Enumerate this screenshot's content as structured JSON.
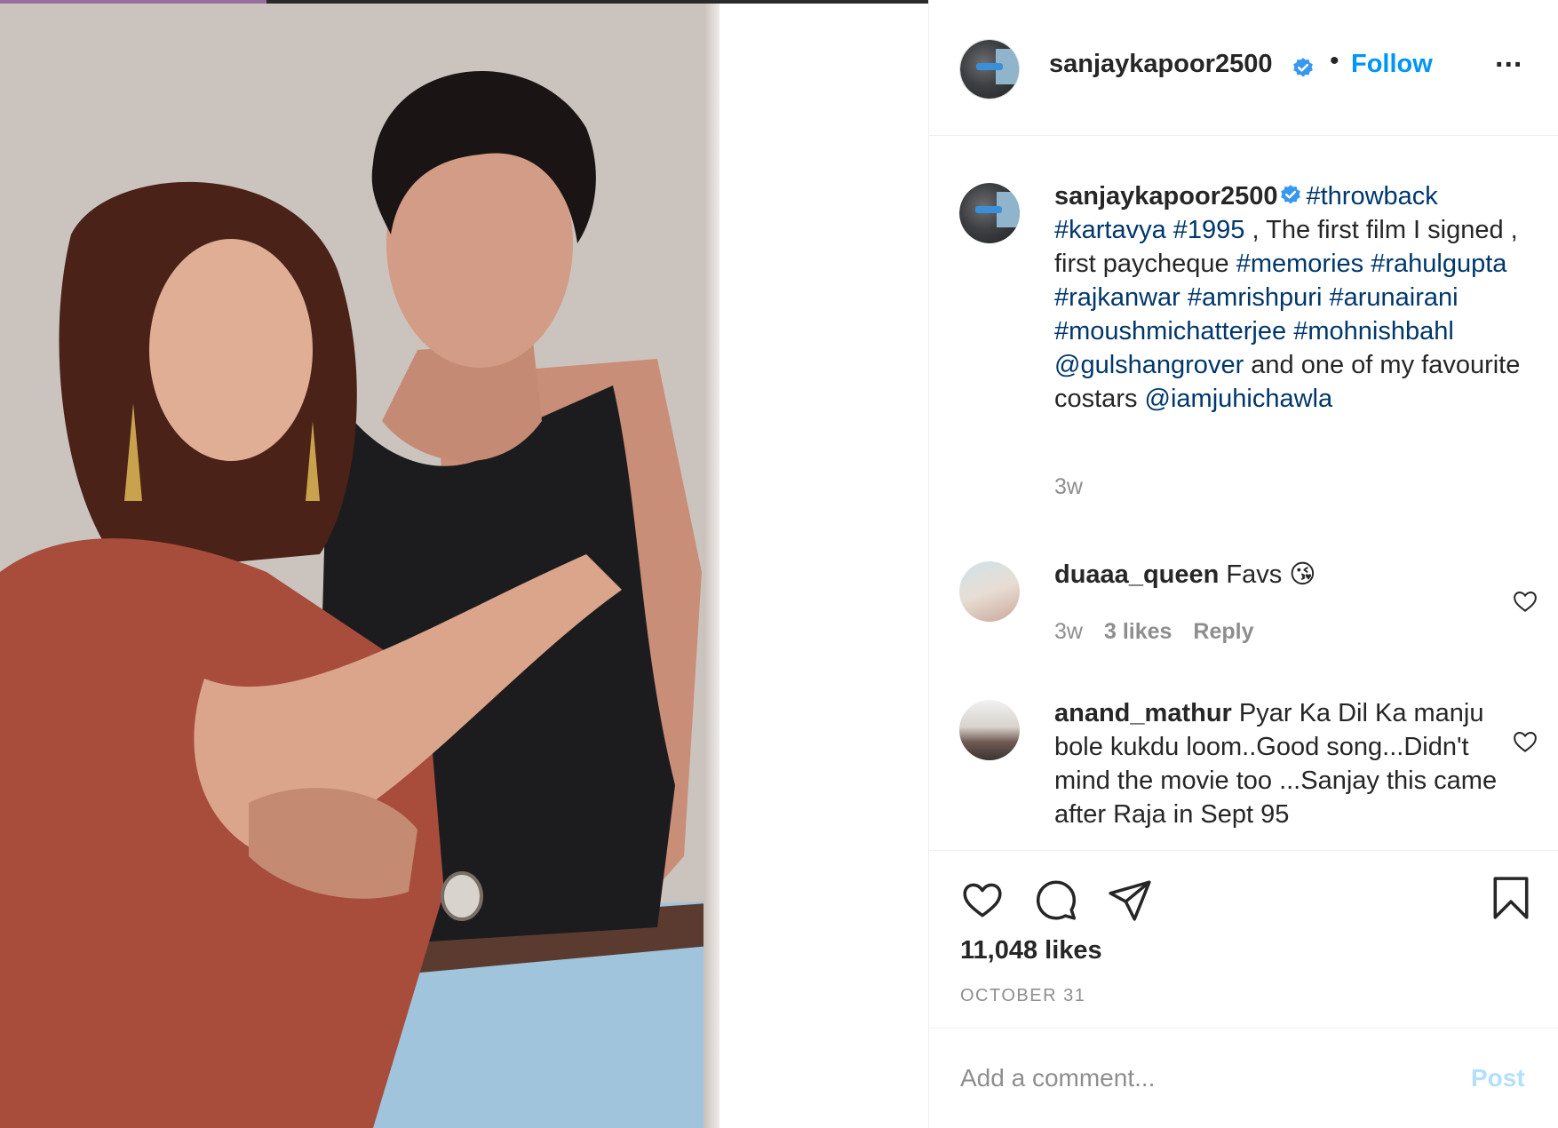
{
  "post": {
    "author": "sanjaykapoor2500",
    "follow_label": "Follow",
    "separator": "•",
    "more_label": "...",
    "likes": "11,048 likes",
    "date": "OCTOBER 31"
  },
  "caption": {
    "username": "sanjaykapoor2500",
    "segments": [
      {
        "t": "#throwback",
        "tag": true
      },
      {
        "t": " ",
        "tag": false
      },
      {
        "t": "#kartavya",
        "tag": true
      },
      {
        "t": " ",
        "tag": false
      },
      {
        "t": "#1995",
        "tag": true
      },
      {
        "t": " , The first film I signed , first paycheque ",
        "tag": false
      },
      {
        "t": "#memories",
        "tag": true
      },
      {
        "t": " ",
        "tag": false
      },
      {
        "t": "#rahulgupta",
        "tag": true
      },
      {
        "t": " ",
        "tag": false
      },
      {
        "t": "#rajkanwar",
        "tag": true
      },
      {
        "t": " ",
        "tag": false
      },
      {
        "t": "#amrishpuri",
        "tag": true
      },
      {
        "t": " ",
        "tag": false
      },
      {
        "t": "#arunairani",
        "tag": true
      },
      {
        "t": " ",
        "tag": false
      },
      {
        "t": "#moushmichatterjee",
        "tag": true
      },
      {
        "t": " ",
        "tag": false
      },
      {
        "t": "#mohnishbahl",
        "tag": true
      },
      {
        "t": " ",
        "tag": false
      },
      {
        "t": "@gulshangrover",
        "tag": true
      },
      {
        "t": " and one of my favourite costars ",
        "tag": false
      },
      {
        "t": "@iamjuhichawla",
        "tag": true
      }
    ],
    "time": "3w"
  },
  "comments": [
    {
      "username": "duaaa_queen",
      "text": "Favs 😘",
      "time": "3w",
      "likes": "3 likes",
      "reply_label": "Reply"
    },
    {
      "username": "anand_mathur",
      "text": "Pyar Ka Dil Ka manju bole kukdu loom..Good song...Didn't mind the movie too ...Sanjay this came after Raja in Sept 95"
    }
  ],
  "add_comment": {
    "placeholder": "Add a comment...",
    "post_label": "Post"
  },
  "colors": {
    "link_blue": "#0095f6",
    "tag_navy": "#00376b",
    "muted": "#8e8e8e",
    "post_disabled": "#b2dffc",
    "verified_blue": "#3897f0"
  },
  "icons": {
    "verified": "verified-badge-icon",
    "like": "heart-icon",
    "comment": "comment-bubble-icon",
    "share": "paper-plane-icon",
    "save": "bookmark-icon",
    "more": "more-options-icon"
  }
}
